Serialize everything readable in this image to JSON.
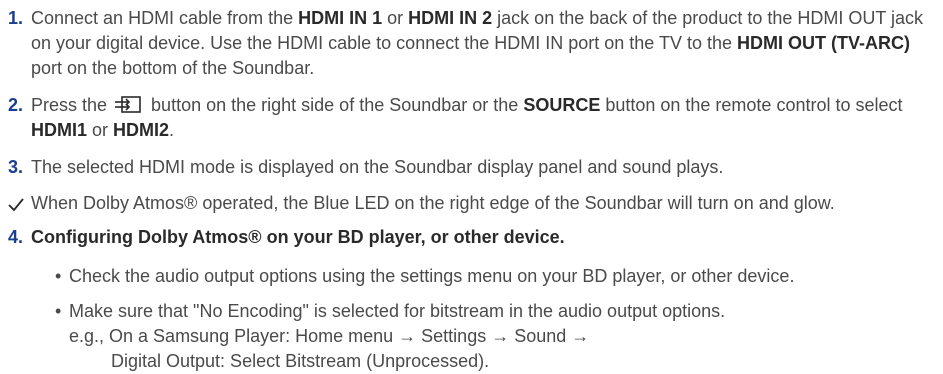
{
  "step1": {
    "num": "1.",
    "p1": "Connect an HDMI cable from the ",
    "b1": "HDMI IN 1",
    "p2": " or ",
    "b2": "HDMI IN 2",
    "p3": " jack on the back of the product to the HDMI OUT jack on your digital device. Use the HDMI cable to connect the HDMI IN port on the TV to the ",
    "b3": "HDMI OUT (TV-ARC)",
    "p4": " port on the bottom of the Soundbar."
  },
  "step2": {
    "num": "2.",
    "p1": "Press the ",
    "icon": "source-button-icon",
    "p2": " button on the right side of the Soundbar or the ",
    "b1": "SOURCE",
    "p3": " button on the remote control to select ",
    "b2": "HDMI1",
    "p4": " or ",
    "b3": "HDMI2",
    "p5": "."
  },
  "step3": {
    "num": "3.",
    "text": "The selected HDMI mode is displayed on the Soundbar display panel and sound plays."
  },
  "note": {
    "icon": "checkmark-icon",
    "text": "When Dolby Atmos® operated, the Blue LED on the right edge of the Soundbar will turn on and glow."
  },
  "step4": {
    "num": "4.",
    "heading": "Configuring Dolby Atmos® on your BD player, or other device."
  },
  "bullets": [
    {
      "text": "Check the audio output options using the settings menu on your BD player, or other device."
    },
    {
      "line1": "Make sure that \"No Encoding\" is selected for bitstream in the audio output options.",
      "line2": "e.g., On a Samsung Player: Home menu → Settings → Sound →",
      "line3": "Digital Output: Select Bitstream (Unprocessed)."
    }
  ],
  "colors": {
    "number": "#1a3d8f",
    "text": "#4a4a4a",
    "bold": "#2a2a2a"
  }
}
